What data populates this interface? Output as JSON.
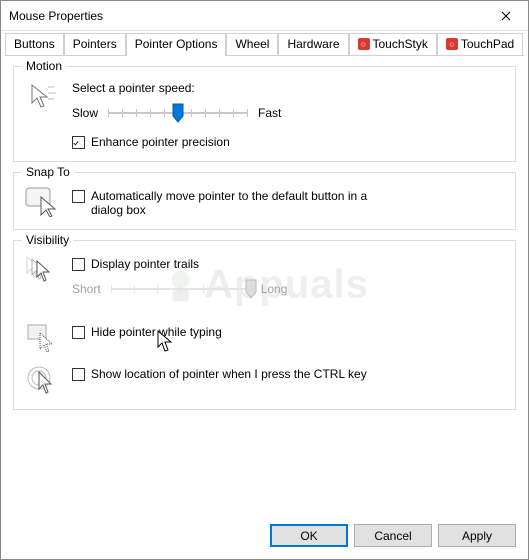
{
  "window": {
    "title": "Mouse Properties"
  },
  "tabs": {
    "buttons": "Buttons",
    "pointers": "Pointers",
    "pointer_options": "Pointer Options",
    "wheel": "Wheel",
    "hardware": "Hardware",
    "touchstyk": "TouchStyk",
    "touchpad": "TouchPad",
    "active": "pointer_options"
  },
  "motion": {
    "group_title": "Motion",
    "speed_label": "Select a pointer speed:",
    "slow": "Slow",
    "fast": "Fast",
    "speed_value": 6,
    "speed_max": 11,
    "enhance_label": "Enhance pointer precision",
    "enhance_checked": true
  },
  "snap_to": {
    "group_title": "Snap To",
    "auto_move_label": "Automatically move pointer to the default button in a dialog box",
    "auto_move_checked": false
  },
  "visibility": {
    "group_title": "Visibility",
    "trails_label": "Display pointer trails",
    "trails_checked": false,
    "short": "Short",
    "long": "Long",
    "hide_typing_label": "Hide pointer while typing",
    "hide_typing_checked": false,
    "ctrl_locate_label": "Show location of pointer when I press the CTRL key",
    "ctrl_locate_checked": false
  },
  "footer": {
    "ok": "OK",
    "cancel": "Cancel",
    "apply": "Apply"
  },
  "watermark": {
    "text": "Appuals"
  }
}
